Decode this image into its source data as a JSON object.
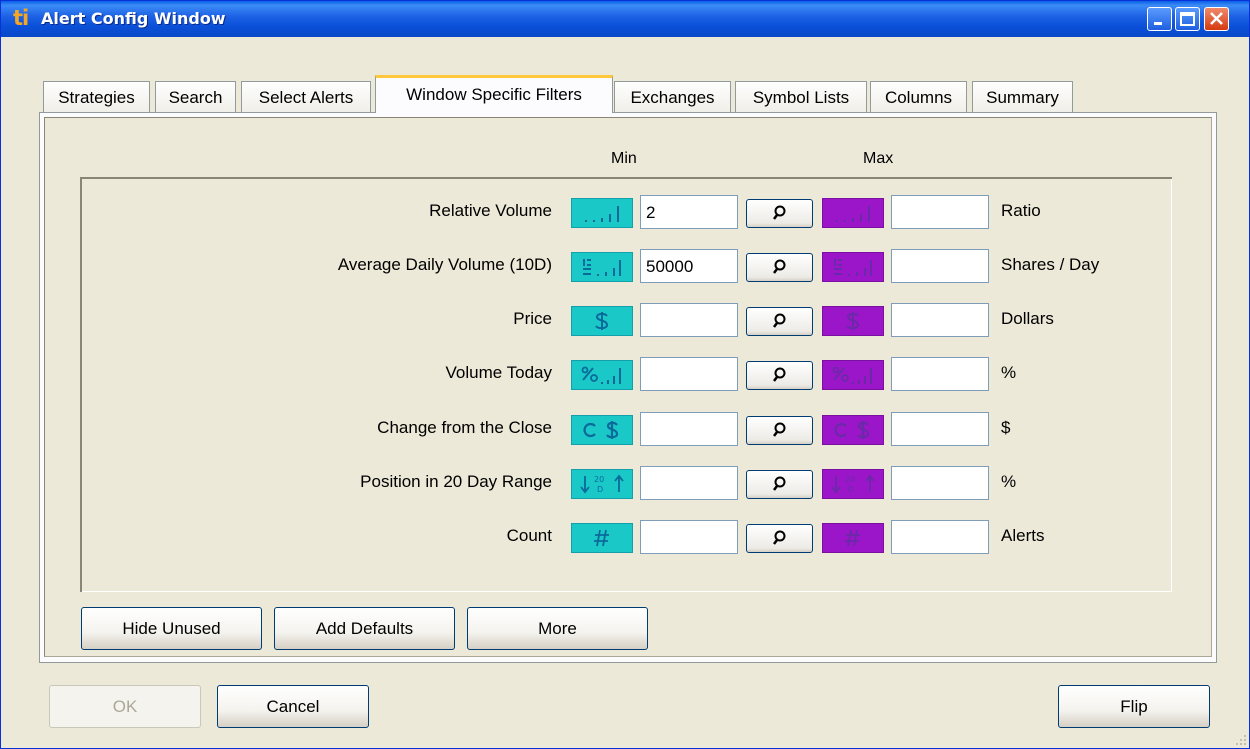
{
  "window": {
    "title": "Alert Config Window",
    "logo": "ti",
    "title_color": "#0a50d8"
  },
  "tabs": [
    "Strategies",
    "Search",
    "Select Alerts",
    "Window Specific Filters",
    "Exchanges",
    "Symbol Lists",
    "Columns",
    "Summary"
  ],
  "active_tab": "Window Specific Filters",
  "filters": {
    "min_header": "Min",
    "max_header": "Max",
    "rows": [
      {
        "label": "Relative Volume",
        "min": "2",
        "max": "",
        "unit": "Ratio",
        "icon": "relative-volume-icon"
      },
      {
        "label": "Average Daily Volume (10D)",
        "min": "50000",
        "max": "",
        "unit": "Shares / Day",
        "icon": "average-volume-icon"
      },
      {
        "label": "Price",
        "min": "",
        "max": "",
        "unit": "Dollars",
        "icon": "dollar-icon"
      },
      {
        "label": "Volume Today",
        "min": "",
        "max": "",
        "unit": "%",
        "icon": "percent-volume-icon"
      },
      {
        "label": "Change from the Close",
        "min": "",
        "max": "",
        "unit": "$",
        "icon": "change-close-icon"
      },
      {
        "label": "Position in 20 Day Range",
        "min": "",
        "max": "",
        "unit": "%",
        "icon": "range-position-icon"
      },
      {
        "label": "Count",
        "min": "",
        "max": "",
        "unit": "Alerts",
        "icon": "hash-icon"
      }
    ],
    "min_color": "#1bc8c8",
    "max_color": "#9b16c8"
  },
  "panel_buttons": {
    "hide_unused": "Hide Unused",
    "add_defaults": "Add Defaults",
    "more": "More"
  },
  "footer": {
    "ok": "OK",
    "cancel": "Cancel",
    "flip": "Flip"
  }
}
